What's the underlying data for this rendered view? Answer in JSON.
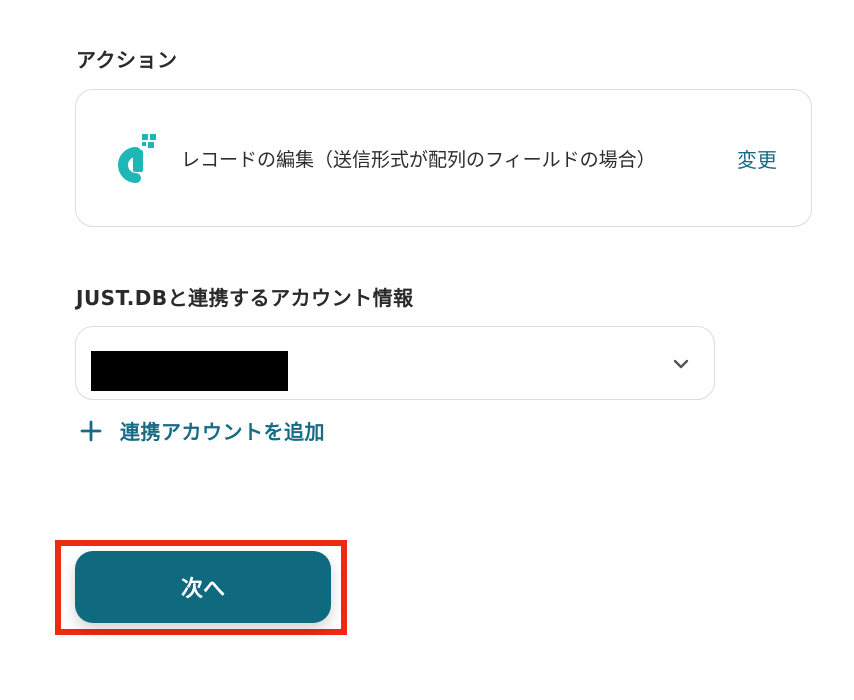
{
  "action": {
    "section_label": "アクション",
    "app_icon": "just-db-logo-icon",
    "action_name": "レコードの編集（送信形式が配列のフィールドの場合）",
    "change_label": "変更"
  },
  "account": {
    "section_label": "JUST.DBと連携するアカウント情報",
    "selected_value": "",
    "chevron_icon": "chevron-down-icon",
    "add_icon": "plus-icon",
    "add_label": "連携アカウントを追加"
  },
  "footer": {
    "next_label": "次へ"
  },
  "colors": {
    "accent": "#176b86",
    "button_bg": "#0f6a80",
    "highlight_border": "#ee2b12",
    "logo_teal": "#1fb7b5"
  }
}
